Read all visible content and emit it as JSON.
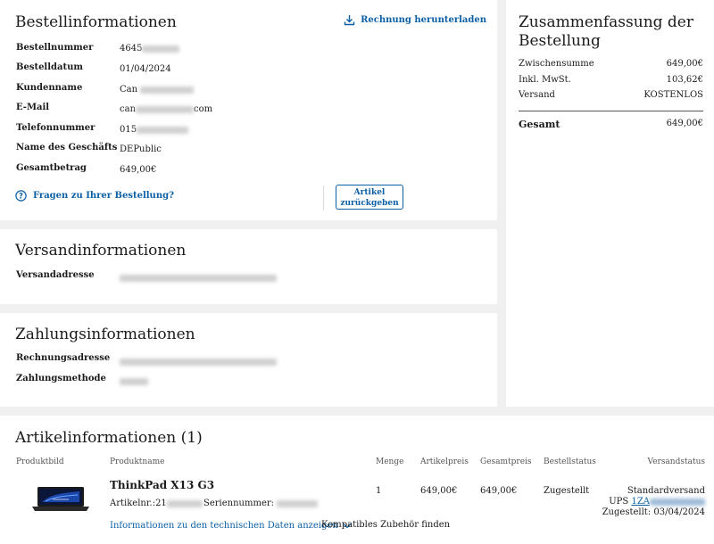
{
  "order": {
    "title": "Bestellinformationen",
    "download_label": "Rechnung herunterladen",
    "fields": [
      {
        "label": "Bestellnummer",
        "value": "4645"
      },
      {
        "label": "Bestelldatum",
        "value": "01/04/2024"
      },
      {
        "label": "Kundenname",
        "value": "Can"
      },
      {
        "label": "E-Mail",
        "value_prefix": "can",
        "value_suffix": "com"
      },
      {
        "label": "Telefonnummer",
        "value": "015"
      },
      {
        "label": "Name des Geschäfts",
        "value": "DEPublic"
      },
      {
        "label": "Gesamtbetrag",
        "value": "649,00€"
      }
    ],
    "help_label": "Fragen zu Ihrer Bestellung?",
    "return_label_line1": "Artikel",
    "return_label_line2": "zurückgeben"
  },
  "summary": {
    "title": "Zusammenfassung der Bestellung",
    "rows": [
      {
        "label": "Zwischensumme",
        "value": "649,00€"
      },
      {
        "label": "Inkl. MwSt.",
        "value": "103,62€"
      },
      {
        "label": "Versand",
        "value": "KOSTENLOS"
      }
    ],
    "total_label": "Gesamt",
    "total_value": "649,00€"
  },
  "shipping": {
    "title": "Versandinformationen",
    "address_label": "Versandadresse"
  },
  "payment": {
    "title": "Zahlungsinformationen",
    "billing_label": "Rechnungsadresse",
    "method_label": "Zahlungsmethode"
  },
  "items": {
    "title": "Artikelinformationen (1)",
    "headers": {
      "image": "Produktbild",
      "name": "Produktname",
      "qty": "Menge",
      "price": "Artikelpreis",
      "total": "Gesamtpreis",
      "order_status": "Bestellstatus",
      "shipping_status": "Versandstatus"
    },
    "product": {
      "name": "ThinkPad X13 G3",
      "article_prefix": "Artikelnr.:21",
      "serial_label": "Seriennummer:",
      "qty": "1",
      "price": "649,00€",
      "total": "649,00€",
      "order_status": "Zugestellt",
      "shipping_method": "Standardversand",
      "carrier": "UPS",
      "tracking_prefix": "1ZA",
      "delivered": "Zugestellt: 03/04/2024",
      "tech_link": "Informationen zu den technischen Daten anzeigen",
      "accessory_link": "Kompatibles Zubehör finden"
    }
  }
}
